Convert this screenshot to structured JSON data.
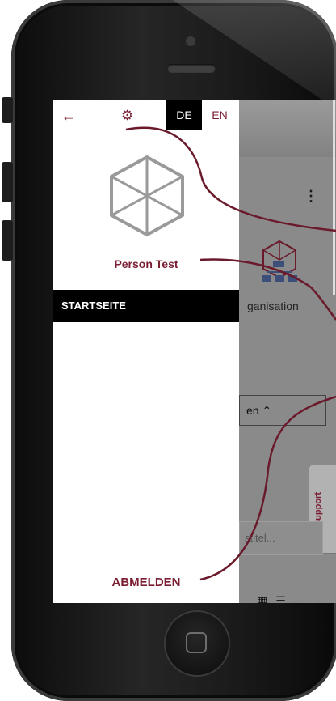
{
  "drawer": {
    "back_icon": "arrow-left-icon",
    "settings_icon": "gear-icon",
    "lang_de": "DE",
    "lang_en": "EN",
    "avatar_icon": "cube-icon",
    "user_name": "Person Test",
    "nav_item_start": "STARTSEITE",
    "logout_label": "ABMELDEN"
  },
  "background_app": {
    "org_label": "ganisation",
    "collapse_button": "en",
    "it_support": "IT-Support",
    "search_placeholder": "stitel..."
  },
  "colors": {
    "accent": "#7a1f33",
    "drawer_bg": "#ffffff",
    "nav_active_bg": "#000000"
  }
}
